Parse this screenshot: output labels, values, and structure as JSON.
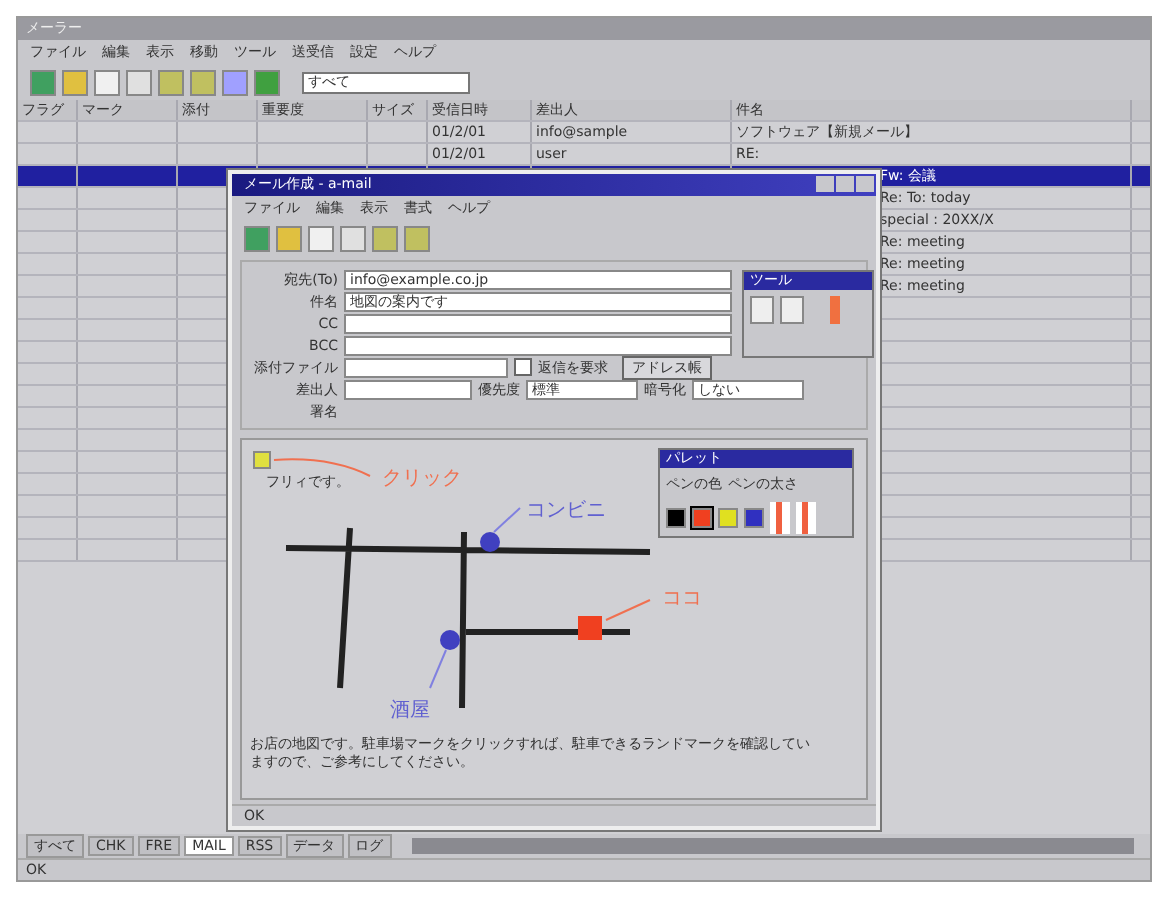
{
  "main": {
    "title": "メーラー",
    "menu": [
      "ファイル",
      "編集",
      "表示",
      "移動",
      "ツール",
      "送受信",
      "設定",
      "ヘルプ"
    ],
    "search": {
      "value": "すべて"
    },
    "columns": [
      "フラグ",
      "マーク",
      "添付",
      "重要度",
      "サイズ",
      "受信日時",
      "差出人",
      "件名"
    ],
    "rows": [
      {
        "selected": false,
        "date": "01/2/01",
        "from": "info@sample",
        "subject": "ソフトウェア【新規メール】"
      },
      {
        "selected": false,
        "date": "01/2/01",
        "from": "user",
        "subject": "RE:"
      },
      {
        "selected": true,
        "subject": "Fw: 会議"
      },
      {
        "selected": false,
        "subject": "Re: To: today"
      },
      {
        "selected": false,
        "subject": "special : 20XX/X"
      },
      {
        "selected": false,
        "subject": "Re: meeting"
      },
      {
        "selected": false,
        "subject": "Re: meeting"
      },
      {
        "selected": false,
        "subject": "Re: meeting"
      }
    ],
    "tabs": [
      {
        "label": "すべて",
        "selected": false
      },
      {
        "label": "CHK",
        "selected": false
      },
      {
        "label": "FRE",
        "selected": false
      },
      {
        "label": "MAIL",
        "selected": true
      },
      {
        "label": "RSS",
        "selected": false
      },
      {
        "label": "データ",
        "selected": false
      },
      {
        "label": "ログ",
        "selected": false
      }
    ],
    "status": "OK"
  },
  "compose": {
    "title": "メール作成 - a-mail",
    "menu": [
      "ファイル",
      "編集",
      "表示",
      "書式",
      "ヘルプ"
    ],
    "fields": [
      {
        "label": "宛先(To)",
        "value": "info@example.co.jp"
      },
      {
        "label": "件名",
        "value": "地図の案内です"
      },
      {
        "label": "CC"
      },
      {
        "label": "BCC"
      }
    ],
    "attach_label": "添付ファイル",
    "request_reply": {
      "label": "返信を要求",
      "checked": false
    },
    "address_button": "アドレス帳",
    "sender_label": "差出人",
    "priority": {
      "label": "優先度",
      "value": "標準"
    },
    "encrypt": {
      "label": "暗号化",
      "value": "しない"
    },
    "signature_label": "署名",
    "greeting": "フリィです。",
    "annotations": [
      "クリック",
      "コンビニ",
      "ココ",
      "酒屋"
    ],
    "message": "お店の地図です。駐車場マークをクリックすれば、駐車できるランドマークを確認していますので、ご参考にしてください。",
    "status": "OK"
  },
  "palette": {
    "title": "パレット",
    "pen_color_label": "ペンの色",
    "pen_width_label": "ペンの太さ",
    "colors": [
      {
        "color": "#000000",
        "selected": false
      },
      {
        "color": "#f04020",
        "selected": true
      },
      {
        "color": "#e0e020",
        "selected": false
      },
      {
        "color": "#3030c0",
        "selected": false
      }
    ]
  },
  "toolbox": {
    "title": "ツール"
  }
}
